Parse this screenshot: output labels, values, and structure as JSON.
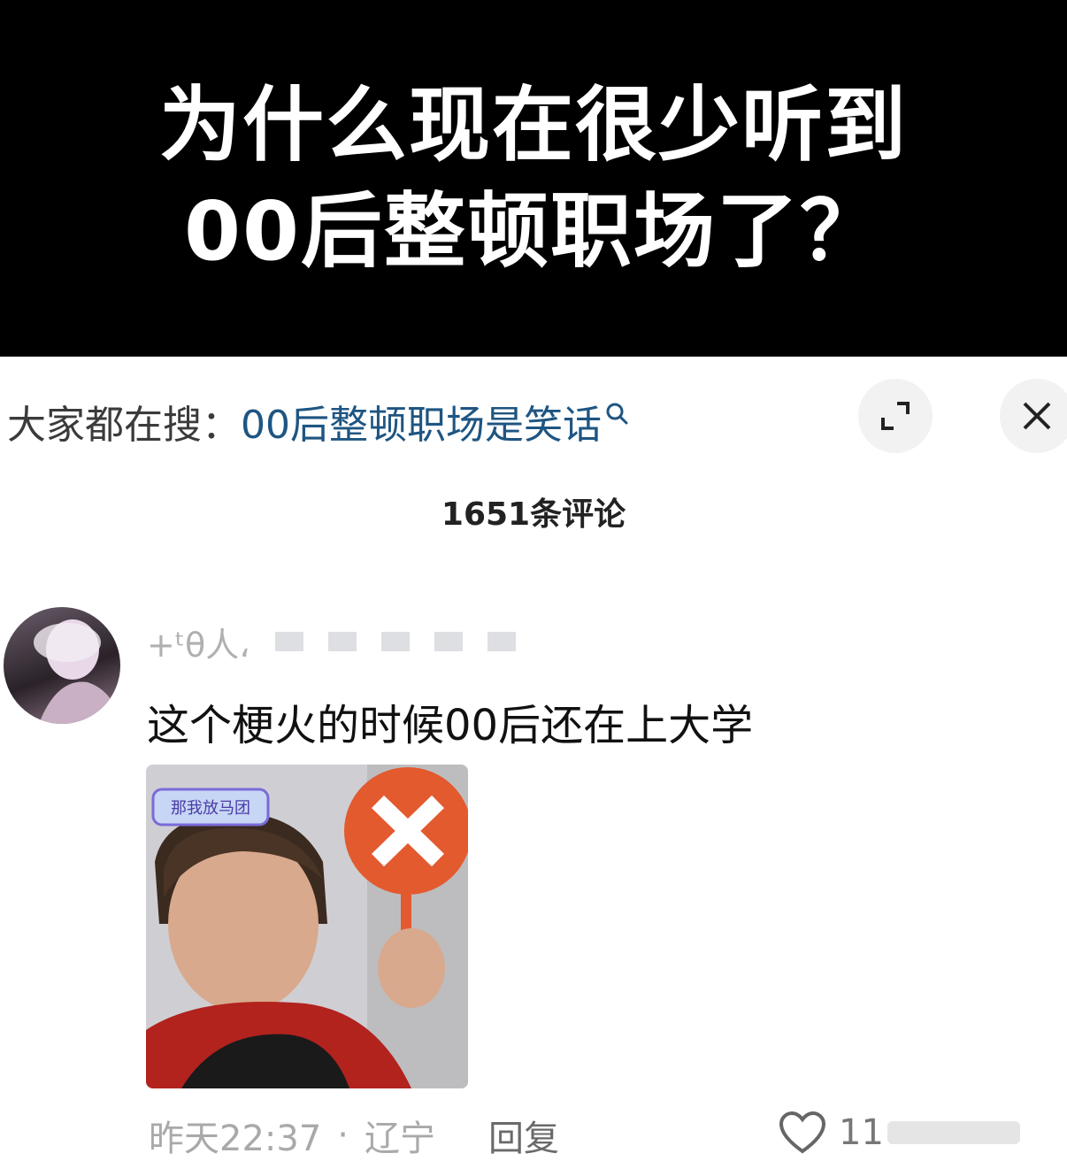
{
  "banner": {
    "line1": "为什么现在很少听到",
    "line2": "00后整顿职场了？"
  },
  "search": {
    "prefix": "大家都在搜：",
    "query": "00后整顿职场是笑话",
    "icon": "search-icon"
  },
  "buttons": {
    "expand_icon": "expand-icon",
    "close_icon": "close-icon"
  },
  "comments_header": "1651条评论",
  "comment": {
    "username": "+ᵗθ人،",
    "text": "这个梗火的时候00后还在上大学",
    "meme_badge": "那我放马团",
    "time": "昨天22:37",
    "location": "辽宁",
    "dot": "·",
    "reply_label": "回复",
    "like_count": "11"
  },
  "colors": {
    "link": "#1e5582",
    "banner_bg": "#000000",
    "meta_gray": "#a9a9a9"
  }
}
